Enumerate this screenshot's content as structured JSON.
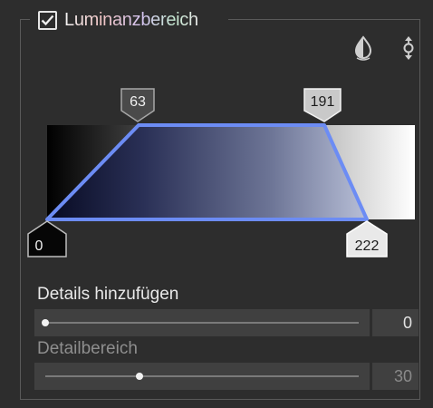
{
  "section": {
    "title": "Luminanzbereich",
    "enabled": true
  },
  "toolbar": {
    "icons": [
      "contrast-drop-icon",
      "vertical-arrows-icon"
    ]
  },
  "range": {
    "top_left": "63",
    "top_right": "191",
    "bottom_left": "0",
    "bottom_right": "222"
  },
  "details": {
    "label": "Details hinzufügen",
    "value": "0",
    "level": 0.0
  },
  "detail_range": {
    "label": "Detailbereich",
    "value": "30",
    "level": 0.3
  }
}
